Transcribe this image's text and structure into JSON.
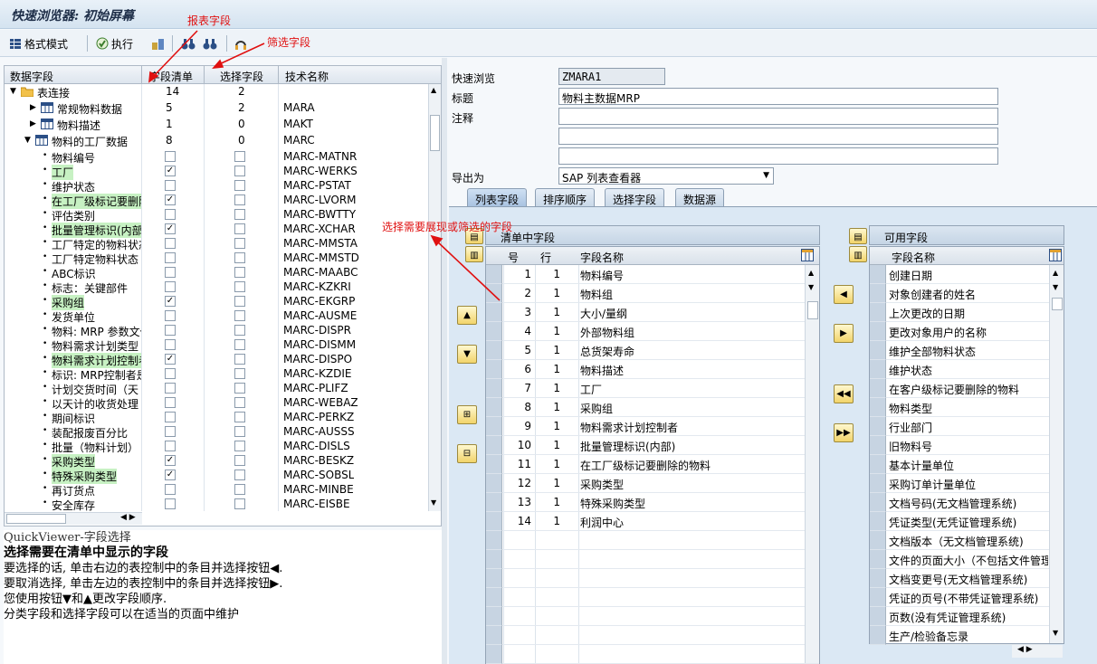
{
  "title": "快速浏览器: 初始屏幕",
  "toolbar": {
    "layout_mode": "格式模式",
    "execute": "执行"
  },
  "annotations": {
    "report_fields": "报表字段",
    "filter_fields": "筛选字段",
    "choose_fields": "选择需要展现或筛选的字段"
  },
  "tree": {
    "headers": [
      "数据字段",
      "字段清单",
      "选择字段",
      "技术名称"
    ],
    "nodes": [
      {
        "label": "表连接",
        "list": "14",
        "sel": "2",
        "tech": ""
      },
      {
        "label": "常规物料数据",
        "list": "5",
        "sel": "2",
        "tech": "MARA"
      },
      {
        "label": "物料描述",
        "list": "1",
        "sel": "0",
        "tech": "MAKT"
      },
      {
        "label": "物料的工厂数据",
        "list": "8",
        "sel": "0",
        "tech": "MARC"
      }
    ],
    "fields": [
      {
        "label": "物料编号",
        "list": false,
        "sel": false,
        "tech": "MARC-MATNR",
        "hl": false
      },
      {
        "label": "工厂",
        "list": true,
        "sel": false,
        "tech": "MARC-WERKS",
        "hl": true
      },
      {
        "label": "维护状态",
        "list": false,
        "sel": false,
        "tech": "MARC-PSTAT",
        "hl": false
      },
      {
        "label": "在工厂级标记要删除",
        "list": true,
        "sel": false,
        "tech": "MARC-LVORM",
        "hl": true
      },
      {
        "label": "评估类别",
        "list": false,
        "sel": false,
        "tech": "MARC-BWTTY",
        "hl": false
      },
      {
        "label": "批量管理标识(内部",
        "list": true,
        "sel": false,
        "tech": "MARC-XCHAR",
        "hl": true
      },
      {
        "label": "工厂特定的物料状态",
        "list": false,
        "sel": false,
        "tech": "MARC-MMSTA",
        "hl": false
      },
      {
        "label": "工厂特定物料状态",
        "list": false,
        "sel": false,
        "tech": "MARC-MMSTD",
        "hl": false
      },
      {
        "label": "ABC标识",
        "list": false,
        "sel": false,
        "tech": "MARC-MAABC",
        "hl": false
      },
      {
        "label": "标志：关键部件",
        "list": false,
        "sel": false,
        "tech": "MARC-KZKRI",
        "hl": false
      },
      {
        "label": "采购组",
        "list": true,
        "sel": false,
        "tech": "MARC-EKGRP",
        "hl": true
      },
      {
        "label": "发货单位",
        "list": false,
        "sel": false,
        "tech": "MARC-AUSME",
        "hl": false
      },
      {
        "label": "物料: MRP 参数文件",
        "list": false,
        "sel": false,
        "tech": "MARC-DISPR",
        "hl": false
      },
      {
        "label": "物料需求计划类型",
        "list": false,
        "sel": false,
        "tech": "MARC-DISMM",
        "hl": false
      },
      {
        "label": "物料需求计划控制者",
        "list": true,
        "sel": false,
        "tech": "MARC-DISPO",
        "hl": true
      },
      {
        "label": "标识: MRP控制者是",
        "list": false,
        "sel": false,
        "tech": "MARC-KZDIE",
        "hl": false
      },
      {
        "label": "计划交货时间（天",
        "list": false,
        "sel": false,
        "tech": "MARC-PLIFZ",
        "hl": false
      },
      {
        "label": "以天计的收货处理",
        "list": false,
        "sel": false,
        "tech": "MARC-WEBAZ",
        "hl": false
      },
      {
        "label": "期间标识",
        "list": false,
        "sel": false,
        "tech": "MARC-PERKZ",
        "hl": false
      },
      {
        "label": "装配报废百分比",
        "list": false,
        "sel": false,
        "tech": "MARC-AUSSS",
        "hl": false
      },
      {
        "label": "批量（物料计划）",
        "list": false,
        "sel": false,
        "tech": "MARC-DISLS",
        "hl": false
      },
      {
        "label": "采购类型",
        "list": true,
        "sel": false,
        "tech": "MARC-BESKZ",
        "hl": true
      },
      {
        "label": "特殊采购类型",
        "list": true,
        "sel": false,
        "tech": "MARC-SOBSL",
        "hl": true
      },
      {
        "label": "再订货点",
        "list": false,
        "sel": false,
        "tech": "MARC-MINBE",
        "hl": false
      },
      {
        "label": "安全库存",
        "list": false,
        "sel": false,
        "tech": "MARC-EISBE",
        "hl": false
      }
    ]
  },
  "help": {
    "heading": "QuickViewer-字段选择",
    "subheading": "选择需要在清单中显示的字段",
    "lines": [
      "要选择的话, 单击右边的表控制中的条目并选择按钮◀.",
      "要取消选择, 单击左边的表控制中的条目并选择按钮▶.",
      "您使用按钮▼和▲更改字段顺序.",
      "分类字段和选择字段可以在适当的页面中维护"
    ]
  },
  "form": {
    "quickview_label": "快速浏览",
    "quickview_value": "ZMARA1",
    "title_label": "标题",
    "title_value": "物料主数据MRP",
    "comment_label": "注释",
    "export_label": "导出为",
    "export_value": "SAP 列表查看器"
  },
  "tabs": [
    "列表字段",
    "排序顺序",
    "选择字段",
    "数据源"
  ],
  "list_grid": {
    "title": "清单中字段",
    "headers": [
      "号",
      "行",
      "字段名称"
    ],
    "rows": [
      {
        "no": "1",
        "line": "1",
        "name": "物料编号"
      },
      {
        "no": "2",
        "line": "1",
        "name": "物料组"
      },
      {
        "no": "3",
        "line": "1",
        "name": "大小/量纲"
      },
      {
        "no": "4",
        "line": "1",
        "name": "外部物料组"
      },
      {
        "no": "5",
        "line": "1",
        "name": "总货架寿命"
      },
      {
        "no": "6",
        "line": "1",
        "name": "物料描述"
      },
      {
        "no": "7",
        "line": "1",
        "name": "工厂"
      },
      {
        "no": "8",
        "line": "1",
        "name": "采购组"
      },
      {
        "no": "9",
        "line": "1",
        "name": "物料需求计划控制者"
      },
      {
        "no": "10",
        "line": "1",
        "name": "批量管理标识(内部)"
      },
      {
        "no": "11",
        "line": "1",
        "name": "在工厂级标记要删除的物料"
      },
      {
        "no": "12",
        "line": "1",
        "name": "采购类型"
      },
      {
        "no": "13",
        "line": "1",
        "name": "特殊采购类型"
      },
      {
        "no": "14",
        "line": "1",
        "name": "利润中心"
      }
    ]
  },
  "avail_grid": {
    "title": "可用字段",
    "header": "字段名称",
    "rows": [
      "创建日期",
      "对象创建者的姓名",
      "上次更改的日期",
      "更改对象用户的名称",
      "维护全部物料状态",
      "维护状态",
      "在客户级标记要删除的物料",
      "物料类型",
      "行业部门",
      "旧物料号",
      "基本计量单位",
      "采购订单计量单位",
      "文档号码(无文档管理系统)",
      "凭证类型(无凭证管理系统)",
      "文档版本（无文档管理系统)",
      "文件的页面大小（不包括文件管理",
      "文档变更号(无文档管理系统)",
      "凭证的页号(不带凭证管理系统)",
      "页数(没有凭证管理系统)",
      "生产/检验备忘录"
    ]
  }
}
